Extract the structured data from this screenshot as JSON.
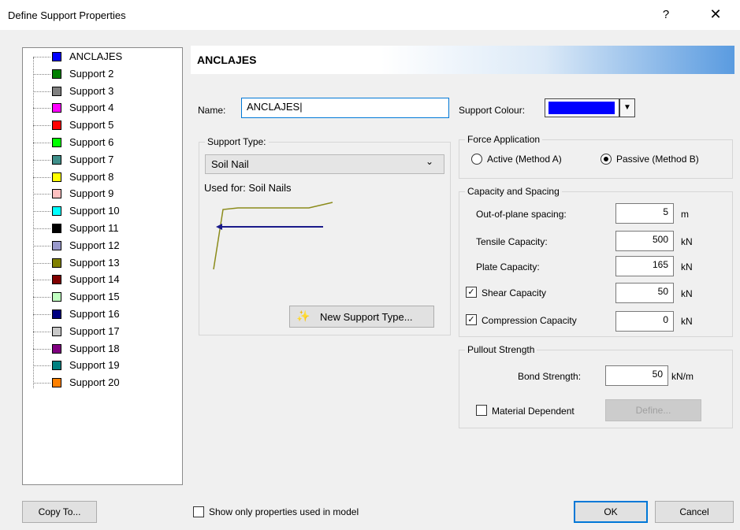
{
  "window": {
    "title": "Define Support Properties",
    "help_glyph": "?",
    "close_glyph": "✕"
  },
  "tree": {
    "items": [
      {
        "label": "ANCLAJES",
        "color": "#0000ff"
      },
      {
        "label": "Support 2",
        "color": "#008000"
      },
      {
        "label": "Support 3",
        "color": "#808080"
      },
      {
        "label": "Support 4",
        "color": "#ff00ff"
      },
      {
        "label": "Support 5",
        "color": "#ff0000"
      },
      {
        "label": "Support 6",
        "color": "#00ff00"
      },
      {
        "label": "Support 7",
        "color": "#3f8f8a"
      },
      {
        "label": "Support 8",
        "color": "#ffff00"
      },
      {
        "label": "Support 9",
        "color": "#ffc0c0"
      },
      {
        "label": "Support 10",
        "color": "#00ffff"
      },
      {
        "label": "Support 11",
        "color": "#000000"
      },
      {
        "label": "Support 12",
        "color": "#9999cc"
      },
      {
        "label": "Support 13",
        "color": "#808000"
      },
      {
        "label": "Support 14",
        "color": "#800000"
      },
      {
        "label": "Support 15",
        "color": "#c0ffc0"
      },
      {
        "label": "Support 16",
        "color": "#000080"
      },
      {
        "label": "Support 17",
        "color": "#c8c8c8"
      },
      {
        "label": "Support 18",
        "color": "#800080"
      },
      {
        "label": "Support 19",
        "color": "#008080"
      },
      {
        "label": "Support 20",
        "color": "#ff8000"
      }
    ]
  },
  "header": {
    "banner_title": "ANCLAJES"
  },
  "name": {
    "label": "Name:",
    "value": "ANCLAJES"
  },
  "support_colour": {
    "label": "Support Colour:",
    "value": "#0000ff"
  },
  "support_type": {
    "group_title": "Support Type:",
    "selected": "Soil Nail",
    "used_for": "Used for: Soil Nails",
    "new_button": "New Support Type..."
  },
  "force_application": {
    "group_title": "Force Application",
    "active_label": "Active (Method A)",
    "passive_label": "Passive (Method B)",
    "selected": "passive"
  },
  "capacity": {
    "group_title": "Capacity and Spacing",
    "out_of_plane": {
      "label": "Out-of-plane spacing:",
      "value": "5",
      "unit": "m"
    },
    "tensile": {
      "label": "Tensile Capacity:",
      "value": "500",
      "unit": "kN"
    },
    "plate": {
      "label": "Plate Capacity:",
      "value": "165",
      "unit": "kN"
    },
    "shear": {
      "label": "Shear Capacity",
      "value": "50",
      "unit": "kN",
      "checked": true
    },
    "compression": {
      "label": "Compression Capacity",
      "value": "0",
      "unit": "kN",
      "checked": true
    }
  },
  "pullout": {
    "group_title": "Pullout Strength",
    "bond": {
      "label": "Bond Strength:",
      "value": "50",
      "unit": "kN/m"
    },
    "material_dependent": {
      "label": "Material Dependent",
      "checked": false
    },
    "define_button": "Define..."
  },
  "footer": {
    "copy_to": "Copy To...",
    "show_only_label": "Show only properties used in model",
    "ok": "OK",
    "cancel": "Cancel"
  }
}
